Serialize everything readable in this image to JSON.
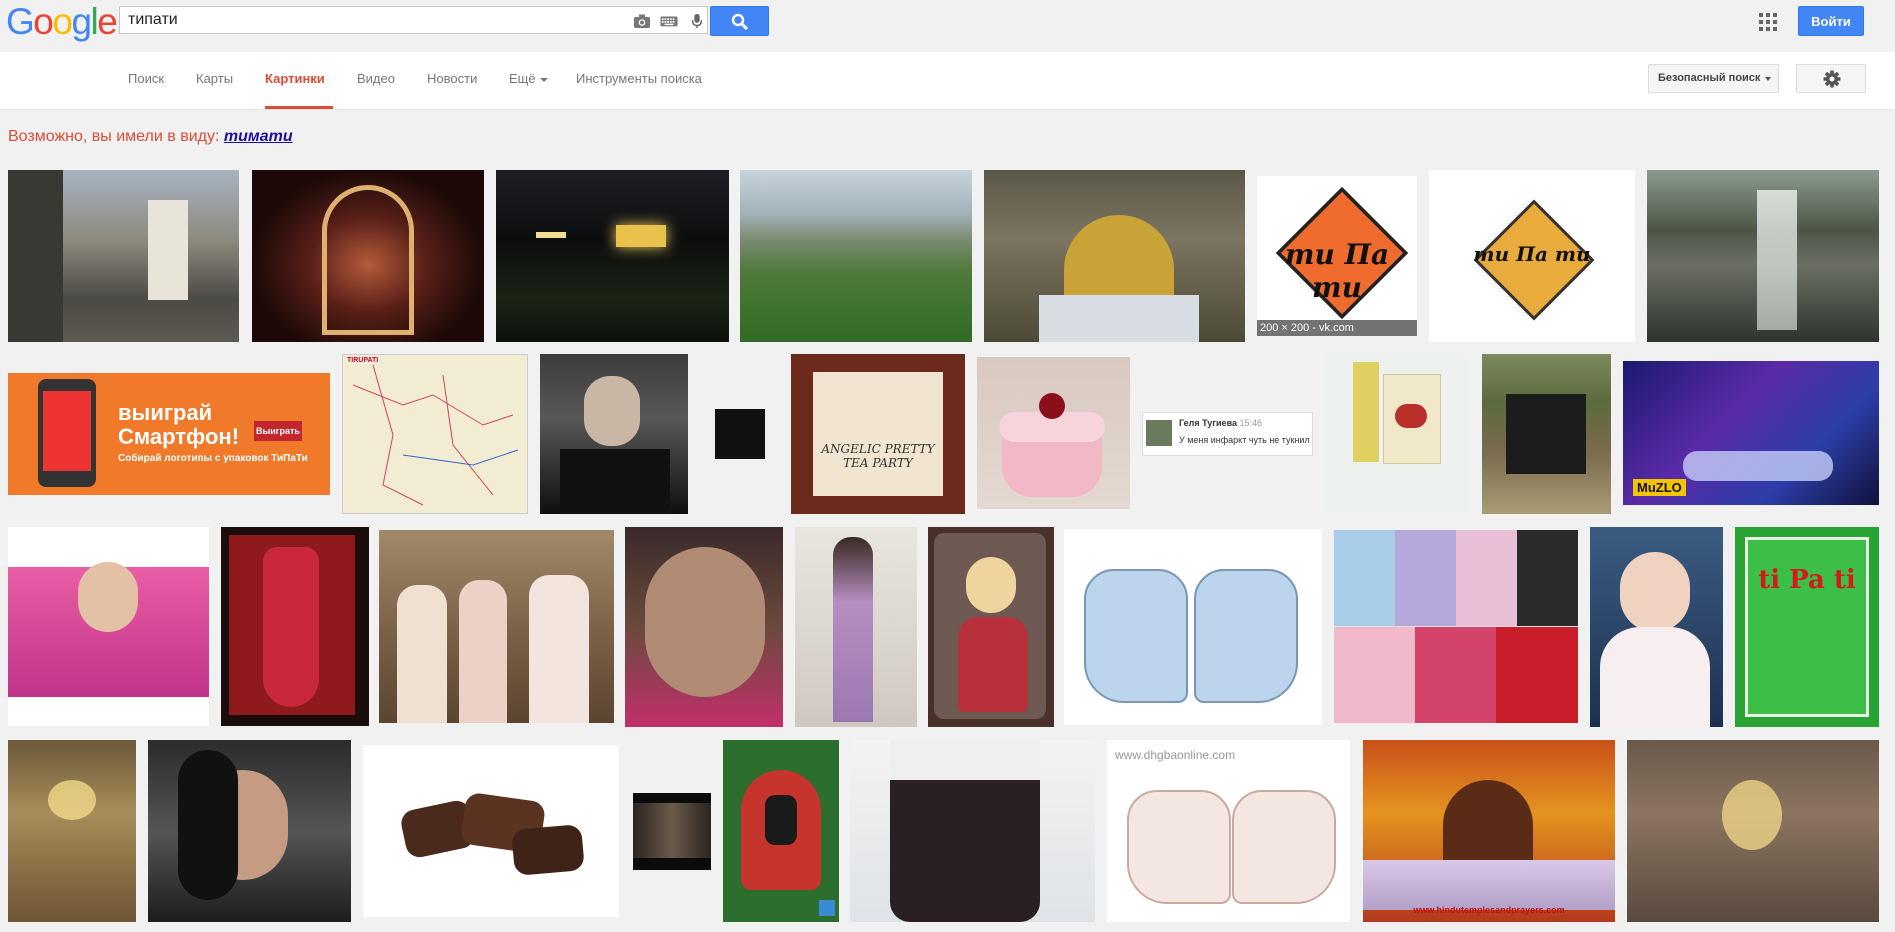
{
  "header": {
    "logo_letters": [
      {
        "ch": "G",
        "color": "#4285f4"
      },
      {
        "ch": "o",
        "color": "#ea4335"
      },
      {
        "ch": "o",
        "color": "#fbbc05"
      },
      {
        "ch": "g",
        "color": "#4285f4"
      },
      {
        "ch": "l",
        "color": "#34a853"
      },
      {
        "ch": "e",
        "color": "#ea4335"
      }
    ],
    "search_value": "типати",
    "signin_label": "Войти"
  },
  "nav": {
    "tabs": [
      {
        "label": "Поиск",
        "active": false
      },
      {
        "label": "Карты",
        "active": false
      },
      {
        "label": "Картинки",
        "active": true
      },
      {
        "label": "Видео",
        "active": false
      },
      {
        "label": "Новости",
        "active": false
      },
      {
        "label": "Ещё",
        "active": false
      },
      {
        "label": "Инструменты поиска",
        "active": false
      }
    ],
    "safesearch_label": "Безопасный поиск"
  },
  "did_you_mean": {
    "prefix": "Возможно, вы имели в виду:",
    "suggestion": "тимати"
  },
  "thumbnails": {
    "t6": {
      "caption": "200 × 200 - vk.com",
      "logo": "ти Па ти"
    },
    "t7": {
      "logo": "ти Па ти"
    },
    "t9": {
      "headline": "выиграй Смартфон!",
      "button": "Выиграть",
      "sub": "Собирай логотипы с упаковок ТиПаТи"
    },
    "t10": {
      "label": "TIRUPATI"
    },
    "t14": {
      "line1": "ANGELIC PRETTY",
      "line2": "TEA PARTY"
    },
    "t16": {
      "name": "Геля Тугиева",
      "time": "15:46",
      "text": "У меня инфаркт чуть не тукнил"
    },
    "t19": {
      "logo": "MuZLO"
    },
    "t29": {
      "title": "ti Pa ti"
    },
    "t34": {
      "watermark": "www.dhgbaonline.com"
    },
    "t35": {
      "url": "www.hindutemplesandprayers.com"
    }
  },
  "colors": {
    "accent_red": "#dd4b39",
    "link_blue": "#1a0dab",
    "button_blue": "#4285f4"
  }
}
